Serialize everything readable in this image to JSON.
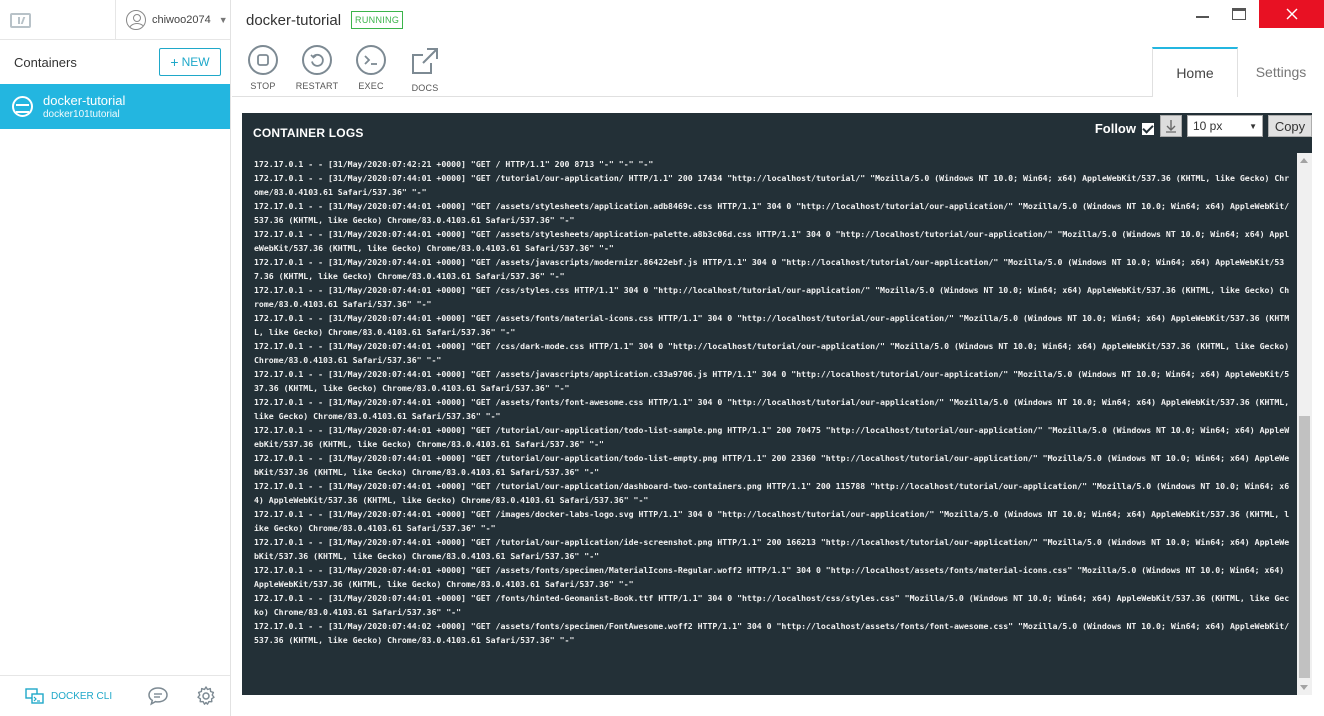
{
  "sidebar": {
    "user": {
      "name": "chiwoo2074"
    },
    "header_title": "Containers",
    "new_label": "NEW",
    "containers": [
      {
        "name": "docker-tutorial",
        "image": "docker101tutorial"
      }
    ],
    "footer": {
      "cli_label": "DOCKER CLI"
    }
  },
  "main": {
    "container_name": "docker-tutorial",
    "status": "RUNNING",
    "toolbar": {
      "stop": "STOP",
      "restart": "RESTART",
      "exec": "EXEC",
      "docs": "DOCS"
    },
    "tabs": [
      {
        "label": "Home"
      },
      {
        "label": "Settings"
      }
    ]
  },
  "logs": {
    "title": "CONTAINER LOGS",
    "follow_label": "Follow",
    "follow_checked": true,
    "font_size": "10 px",
    "copy_label": "Copy",
    "text": "172.17.0.1 - - [31/May/2020:07:42:21 +0000] \"GET / HTTP/1.1\" 200 8713 \"-\" \"-\" \"-\"\n172.17.0.1 - - [31/May/2020:07:44:01 +0000] \"GET /tutorial/our-application/ HTTP/1.1\" 200 17434 \"http://localhost/tutorial/\" \"Mozilla/5.0 (Windows NT 10.0; Win64; x64) AppleWebKit/537.36 (KHTML, like Gecko) Chrome/83.0.4103.61 Safari/537.36\" \"-\"\n172.17.0.1 - - [31/May/2020:07:44:01 +0000] \"GET /assets/stylesheets/application.adb8469c.css HTTP/1.1\" 304 0 \"http://localhost/tutorial/our-application/\" \"Mozilla/5.0 (Windows NT 10.0; Win64; x64) AppleWebKit/537.36 (KHTML, like Gecko) Chrome/83.0.4103.61 Safari/537.36\" \"-\"\n172.17.0.1 - - [31/May/2020:07:44:01 +0000] \"GET /assets/stylesheets/application-palette.a8b3c06d.css HTTP/1.1\" 304 0 \"http://localhost/tutorial/our-application/\" \"Mozilla/5.0 (Windows NT 10.0; Win64; x64) AppleWebKit/537.36 (KHTML, like Gecko) Chrome/83.0.4103.61 Safari/537.36\" \"-\"\n172.17.0.1 - - [31/May/2020:07:44:01 +0000] \"GET /assets/javascripts/modernizr.86422ebf.js HTTP/1.1\" 304 0 \"http://localhost/tutorial/our-application/\" \"Mozilla/5.0 (Windows NT 10.0; Win64; x64) AppleWebKit/537.36 (KHTML, like Gecko) Chrome/83.0.4103.61 Safari/537.36\" \"-\"\n172.17.0.1 - - [31/May/2020:07:44:01 +0000] \"GET /css/styles.css HTTP/1.1\" 304 0 \"http://localhost/tutorial/our-application/\" \"Mozilla/5.0 (Windows NT 10.0; Win64; x64) AppleWebKit/537.36 (KHTML, like Gecko) Chrome/83.0.4103.61 Safari/537.36\" \"-\"\n172.17.0.1 - - [31/May/2020:07:44:01 +0000] \"GET /assets/fonts/material-icons.css HTTP/1.1\" 304 0 \"http://localhost/tutorial/our-application/\" \"Mozilla/5.0 (Windows NT 10.0; Win64; x64) AppleWebKit/537.36 (KHTML, like Gecko) Chrome/83.0.4103.61 Safari/537.36\" \"-\"\n172.17.0.1 - - [31/May/2020:07:44:01 +0000] \"GET /css/dark-mode.css HTTP/1.1\" 304 0 \"http://localhost/tutorial/our-application/\" \"Mozilla/5.0 (Windows NT 10.0; Win64; x64) AppleWebKit/537.36 (KHTML, like Gecko) Chrome/83.0.4103.61 Safari/537.36\" \"-\"\n172.17.0.1 - - [31/May/2020:07:44:01 +0000] \"GET /assets/javascripts/application.c33a9706.js HTTP/1.1\" 304 0 \"http://localhost/tutorial/our-application/\" \"Mozilla/5.0 (Windows NT 10.0; Win64; x64) AppleWebKit/537.36 (KHTML, like Gecko) Chrome/83.0.4103.61 Safari/537.36\" \"-\"\n172.17.0.1 - - [31/May/2020:07:44:01 +0000] \"GET /assets/fonts/font-awesome.css HTTP/1.1\" 304 0 \"http://localhost/tutorial/our-application/\" \"Mozilla/5.0 (Windows NT 10.0; Win64; x64) AppleWebKit/537.36 (KHTML, like Gecko) Chrome/83.0.4103.61 Safari/537.36\" \"-\"\n172.17.0.1 - - [31/May/2020:07:44:01 +0000] \"GET /tutorial/our-application/todo-list-sample.png HTTP/1.1\" 200 70475 \"http://localhost/tutorial/our-application/\" \"Mozilla/5.0 (Windows NT 10.0; Win64; x64) AppleWebKit/537.36 (KHTML, like Gecko) Chrome/83.0.4103.61 Safari/537.36\" \"-\"\n172.17.0.1 - - [31/May/2020:07:44:01 +0000] \"GET /tutorial/our-application/todo-list-empty.png HTTP/1.1\" 200 23360 \"http://localhost/tutorial/our-application/\" \"Mozilla/5.0 (Windows NT 10.0; Win64; x64) AppleWebKit/537.36 (KHTML, like Gecko) Chrome/83.0.4103.61 Safari/537.36\" \"-\"\n172.17.0.1 - - [31/May/2020:07:44:01 +0000] \"GET /tutorial/our-application/dashboard-two-containers.png HTTP/1.1\" 200 115788 \"http://localhost/tutorial/our-application/\" \"Mozilla/5.0 (Windows NT 10.0; Win64; x64) AppleWebKit/537.36 (KHTML, like Gecko) Chrome/83.0.4103.61 Safari/537.36\" \"-\"\n172.17.0.1 - - [31/May/2020:07:44:01 +0000] \"GET /images/docker-labs-logo.svg HTTP/1.1\" 304 0 \"http://localhost/tutorial/our-application/\" \"Mozilla/5.0 (Windows NT 10.0; Win64; x64) AppleWebKit/537.36 (KHTML, like Gecko) Chrome/83.0.4103.61 Safari/537.36\" \"-\"\n172.17.0.1 - - [31/May/2020:07:44:01 +0000] \"GET /tutorial/our-application/ide-screenshot.png HTTP/1.1\" 200 166213 \"http://localhost/tutorial/our-application/\" \"Mozilla/5.0 (Windows NT 10.0; Win64; x64) AppleWebKit/537.36 (KHTML, like Gecko) Chrome/83.0.4103.61 Safari/537.36\" \"-\"\n172.17.0.1 - - [31/May/2020:07:44:01 +0000] \"GET /assets/fonts/specimen/MaterialIcons-Regular.woff2 HTTP/1.1\" 304 0 \"http://localhost/assets/fonts/material-icons.css\" \"Mozilla/5.0 (Windows NT 10.0; Win64; x64) AppleWebKit/537.36 (KHTML, like Gecko) Chrome/83.0.4103.61 Safari/537.36\" \"-\"\n172.17.0.1 - - [31/May/2020:07:44:01 +0000] \"GET /fonts/hinted-Geomanist-Book.ttf HTTP/1.1\" 304 0 \"http://localhost/css/styles.css\" \"Mozilla/5.0 (Windows NT 10.0; Win64; x64) AppleWebKit/537.36 (KHTML, like Gecko) Chrome/83.0.4103.61 Safari/537.36\" \"-\"\n172.17.0.1 - - [31/May/2020:07:44:02 +0000] \"GET /assets/fonts/specimen/FontAwesome.woff2 HTTP/1.1\" 304 0 \"http://localhost/assets/fonts/font-awesome.css\" \"Mozilla/5.0 (Windows NT 10.0; Win64; x64) AppleWebKit/537.36 (KHTML, like Gecko) Chrome/83.0.4103.61 Safari/537.36\" \"-\""
  },
  "colors": {
    "accent": "#23b6e0",
    "running": "#3bb44a",
    "log_background": "#233037",
    "close_button": "#e81123"
  },
  "icons": {
    "logo": "kitematic-logo-icon",
    "user": "user-icon",
    "container": "container-icon",
    "stop": "stop-icon",
    "restart": "restart-icon",
    "exec": "terminal-icon",
    "docs": "external-link-icon",
    "cli": "docker-cli-icon",
    "chat": "chat-icon",
    "settings": "gear-icon",
    "download": "download-icon"
  }
}
